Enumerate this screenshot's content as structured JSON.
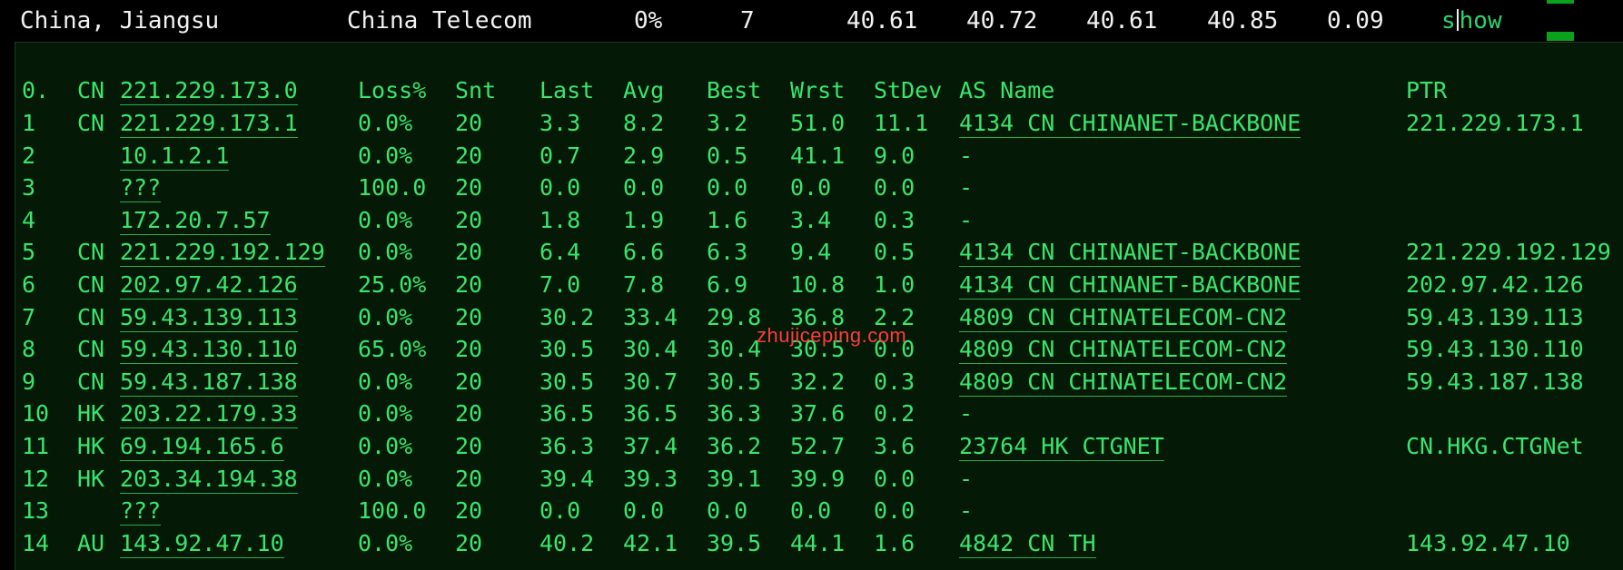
{
  "summary": {
    "location": "China, Jiangsu",
    "isp": "China Telecom",
    "loss": "0%",
    "snt": "7",
    "last": "40.61",
    "avg": "40.72",
    "best": "40.61",
    "wrst": "40.85",
    "stdev": "0.09",
    "action_label": "show"
  },
  "table": {
    "headers": {
      "index": "0.",
      "cc": "CN",
      "host": "221.229.173.0",
      "loss": "Loss%",
      "snt": "Snt",
      "last": "Last",
      "avg": "Avg",
      "best": "Best",
      "wrst": "Wrst",
      "stdev": "StDev",
      "as_name": "AS Name",
      "ptr": "PTR"
    },
    "rows": [
      {
        "hop": "1",
        "cc": "CN",
        "host": "221.229.173.1",
        "loss": "0.0%",
        "snt": "20",
        "last": "3.3",
        "avg": "8.2",
        "best": "3.2",
        "wrst": "51.0",
        "stdev": "11.1",
        "asn": "4134  CN CHINANET-BACKBONE",
        "ptr": "221.229.173.1"
      },
      {
        "hop": "2",
        "cc": "",
        "host": "10.1.2.1",
        "loss": "0.0%",
        "snt": "20",
        "last": "0.7",
        "avg": "2.9",
        "best": "0.5",
        "wrst": "41.1",
        "stdev": "9.0",
        "asn": "-",
        "ptr": ""
      },
      {
        "hop": "3",
        "cc": "",
        "host": "???",
        "loss": "100.0",
        "snt": "20",
        "last": "0.0",
        "avg": "0.0",
        "best": "0.0",
        "wrst": "0.0",
        "stdev": "0.0",
        "asn": "-",
        "ptr": ""
      },
      {
        "hop": "4",
        "cc": "",
        "host": "172.20.7.57",
        "loss": "0.0%",
        "snt": "20",
        "last": "1.8",
        "avg": "1.9",
        "best": "1.6",
        "wrst": "3.4",
        "stdev": "0.3",
        "asn": "-",
        "ptr": ""
      },
      {
        "hop": "5",
        "cc": "CN",
        "host": "221.229.192.129",
        "loss": "0.0%",
        "snt": "20",
        "last": "6.4",
        "avg": "6.6",
        "best": "6.3",
        "wrst": "9.4",
        "stdev": "0.5",
        "asn": "4134  CN CHINANET-BACKBONE",
        "ptr": "221.229.192.129"
      },
      {
        "hop": "6",
        "cc": "CN",
        "host": "202.97.42.126",
        "loss": "25.0%",
        "snt": "20",
        "last": "7.0",
        "avg": "7.8",
        "best": "6.9",
        "wrst": "10.8",
        "stdev": "1.0",
        "asn": "4134  CN CHINANET-BACKBONE",
        "ptr": "202.97.42.126"
      },
      {
        "hop": "7",
        "cc": "CN",
        "host": "59.43.139.113",
        "loss": "0.0%",
        "snt": "20",
        "last": "30.2",
        "avg": "33.4",
        "best": "29.8",
        "wrst": "36.8",
        "stdev": "2.2",
        "asn": "4809  CN CHINATELECOM-CN2",
        "ptr": "59.43.139.113"
      },
      {
        "hop": "8",
        "cc": "CN",
        "host": "59.43.130.110",
        "loss": "65.0%",
        "snt": "20",
        "last": "30.5",
        "avg": "30.4",
        "best": "30.4",
        "wrst": "30.5",
        "stdev": "0.0",
        "asn": "4809  CN CHINATELECOM-CN2",
        "ptr": "59.43.130.110"
      },
      {
        "hop": "9",
        "cc": "CN",
        "host": "59.43.187.138",
        "loss": "0.0%",
        "snt": "20",
        "last": "30.5",
        "avg": "30.7",
        "best": "30.5",
        "wrst": "32.2",
        "stdev": "0.3",
        "asn": "4809  CN CHINATELECOM-CN2",
        "ptr": "59.43.187.138"
      },
      {
        "hop": "10",
        "cc": "HK",
        "host": "203.22.179.33",
        "loss": "0.0%",
        "snt": "20",
        "last": "36.5",
        "avg": "36.5",
        "best": "36.3",
        "wrst": "37.6",
        "stdev": "0.2",
        "asn": "-",
        "ptr": ""
      },
      {
        "hop": "11",
        "cc": "HK",
        "host": "69.194.165.6",
        "loss": "0.0%",
        "snt": "20",
        "last": "36.3",
        "avg": "37.4",
        "best": "36.2",
        "wrst": "52.7",
        "stdev": "3.6",
        "asn": "23764 HK CTGNET",
        "ptr": "CN.HKG.CTGNet"
      },
      {
        "hop": "12",
        "cc": "HK",
        "host": "203.34.194.38",
        "loss": "0.0%",
        "snt": "20",
        "last": "39.4",
        "avg": "39.3",
        "best": "39.1",
        "wrst": "39.9",
        "stdev": "0.0",
        "asn": "-",
        "ptr": ""
      },
      {
        "hop": "13",
        "cc": "",
        "host": "???",
        "loss": "100.0",
        "snt": "20",
        "last": "0.0",
        "avg": "0.0",
        "best": "0.0",
        "wrst": "0.0",
        "stdev": "0.0",
        "asn": "-",
        "ptr": ""
      },
      {
        "hop": "14",
        "cc": "AU",
        "host": "143.92.47.10",
        "loss": "0.0%",
        "snt": "20",
        "last": "40.2",
        "avg": "42.1",
        "best": "39.5",
        "wrst": "44.1",
        "stdev": "1.6",
        "asn": "4842  CN TH",
        "ptr": "143.92.47.10"
      }
    ]
  },
  "watermark": "zhujiceping.com",
  "colors": {
    "terminal_text": "#3be56d",
    "panel_bg": "#041a06",
    "watermark": "#ff3b3b"
  }
}
